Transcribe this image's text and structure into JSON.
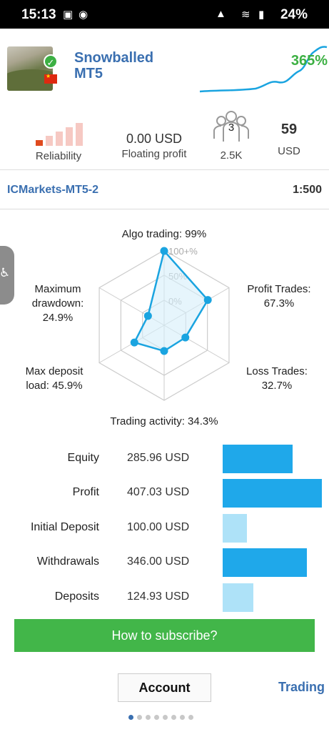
{
  "status_bar": {
    "time": "15:13",
    "battery": "24%"
  },
  "header": {
    "title_line1": "Snowballed",
    "title_line2": "MT5",
    "growth": "365%"
  },
  "stats": {
    "reliability_label": "Reliability",
    "floating_profit_value": "0.00 USD",
    "floating_profit_label": "Floating profit",
    "subscribers_count": "3",
    "subscribers_label": "2.5K",
    "price_value": "59",
    "price_label": "USD"
  },
  "broker": {
    "server": "ICMarkets-MT5-2",
    "leverage": "1:500"
  },
  "radar": {
    "scale_labels": [
      "100+%",
      "50%",
      "0%"
    ],
    "axes": [
      {
        "line1": "Algo trading: 99%",
        "line2": "",
        "value": 99
      },
      {
        "line1": "Profit Trades:",
        "line2": "67.3%",
        "value": 67.3
      },
      {
        "line1": "Loss Trades:",
        "line2": "32.7%",
        "value": 32.7
      },
      {
        "line1": "Trading activity: 34.3%",
        "line2": "",
        "value": 34.3
      },
      {
        "line1": "Max deposit",
        "line2": "load: 45.9%",
        "value": 45.9
      },
      {
        "line1": "Maximum",
        "line2": "drawdown:",
        "line3": "24.9%",
        "value": 24.9
      }
    ],
    "colors": {
      "line": "#1aa4e0",
      "fill": "#d6eefa",
      "grid": "#cccccc"
    }
  },
  "financials": [
    {
      "label": "Equity",
      "value": "285.96 USD",
      "amount": 285.96,
      "type": "balance"
    },
    {
      "label": "Profit",
      "value": "407.03 USD",
      "amount": 407.03,
      "type": "balance"
    },
    {
      "label": "Initial Deposit",
      "value": "100.00 USD",
      "amount": 100.0,
      "type": "deposit"
    },
    {
      "label": "Withdrawals",
      "value": "346.00 USD",
      "amount": 346.0,
      "type": "balance"
    },
    {
      "label": "Deposits",
      "value": "124.93 USD",
      "amount": 124.93,
      "type": "deposit"
    }
  ],
  "bar_colors": {
    "balance": "#1fa8ea",
    "deposit": "#aee2f8"
  },
  "subscribe_label": "How to subscribe?",
  "tabs": {
    "account": "Account",
    "trading": "Trading"
  },
  "pager": {
    "count": 8,
    "active": 0
  }
}
